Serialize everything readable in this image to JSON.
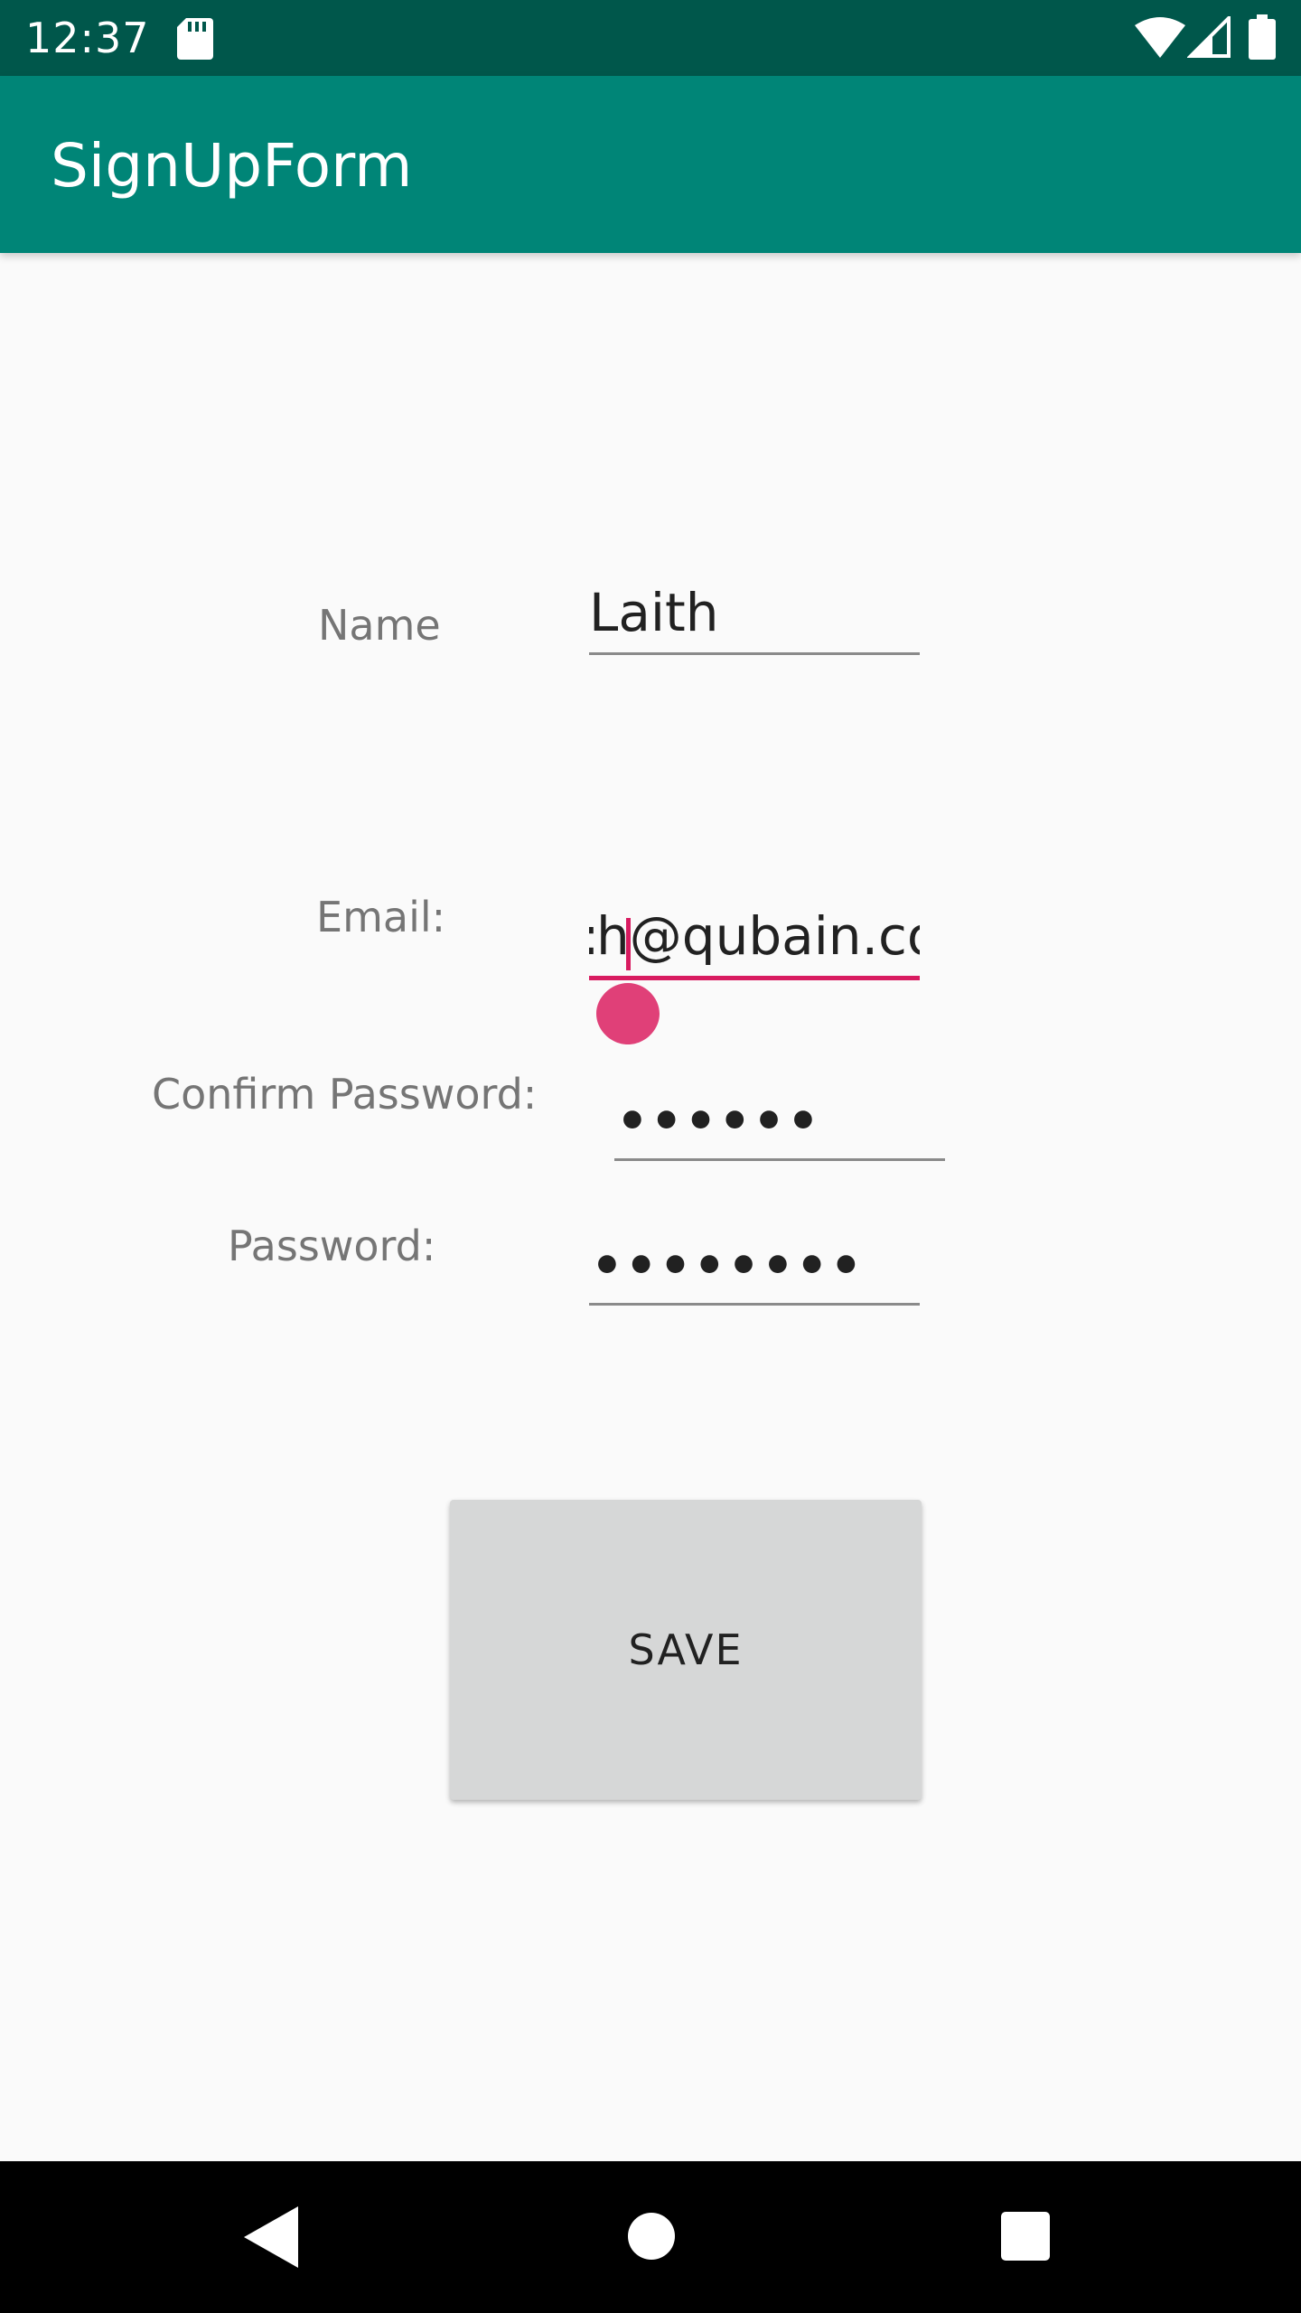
{
  "status_bar": {
    "time": "12:37",
    "icons": [
      "sd-card-icon",
      "wifi-icon",
      "signal-icon",
      "battery-icon"
    ]
  },
  "app_bar": {
    "title": "SignUpForm",
    "color": "#008577"
  },
  "form": {
    "name": {
      "label": "Name",
      "value": "Laith"
    },
    "email": {
      "label": "Email:",
      "value": "h@qubain.co",
      "visible_prefix": ":"
    },
    "confirm_password": {
      "label": "Confirm Password:",
      "masked_value": "••••••"
    },
    "password": {
      "label": "Password:",
      "masked_value": "••••••••"
    },
    "save_label": "SAVE"
  },
  "accent_color": "#d81b60",
  "navigation_bar": {
    "icons": [
      "back-icon",
      "home-icon",
      "recents-icon"
    ]
  }
}
